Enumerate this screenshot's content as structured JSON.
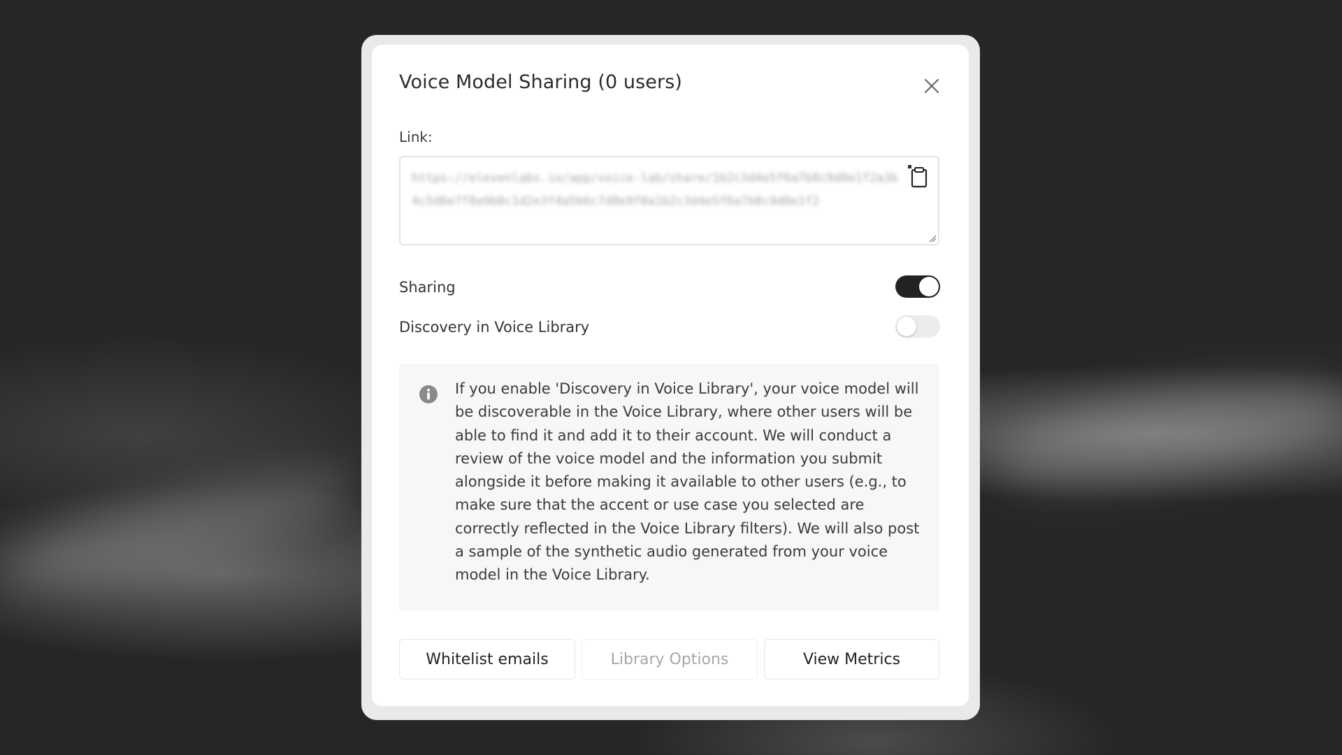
{
  "modal": {
    "title": "Voice Model Sharing (0 users)",
    "link_label": "Link:",
    "link_value": "https://elevenlabs.io/app/voice-lab/share/1b2c3d4e5f6a7b8c9d0e1f2a3b4c5d6e7f8a9b0c1d2e3f4a5b6c7d8e9f0a1b2c3d4e5f6a7b8c9d0e1f2"
  },
  "settings": {
    "sharing_label": "Sharing",
    "sharing_on": true,
    "discovery_label": "Discovery in Voice Library",
    "discovery_on": false
  },
  "info": {
    "text": "If you enable 'Discovery in Voice Library', your voice model will be discoverable in the Voice Library, where other users will be able to find it and add it to their account. We will conduct a review of the voice model and the information you submit alongside it before making it available to other users (e.g., to make sure that the accent or use case you selected are correctly reflected in the Voice Library filters). We will also post a sample of the synthetic audio generated from your voice model in the Voice Library."
  },
  "actions": {
    "whitelist_label": "Whitelist emails",
    "library_options_label": "Library Options",
    "view_metrics_label": "View Metrics"
  },
  "icons": {
    "close": "close-icon",
    "copy": "clipboard-icon",
    "info": "info-icon"
  },
  "colors": {
    "toggle_on": "#222222",
    "toggle_off": "#ececec",
    "panel_bg": "#f7f7f7"
  }
}
